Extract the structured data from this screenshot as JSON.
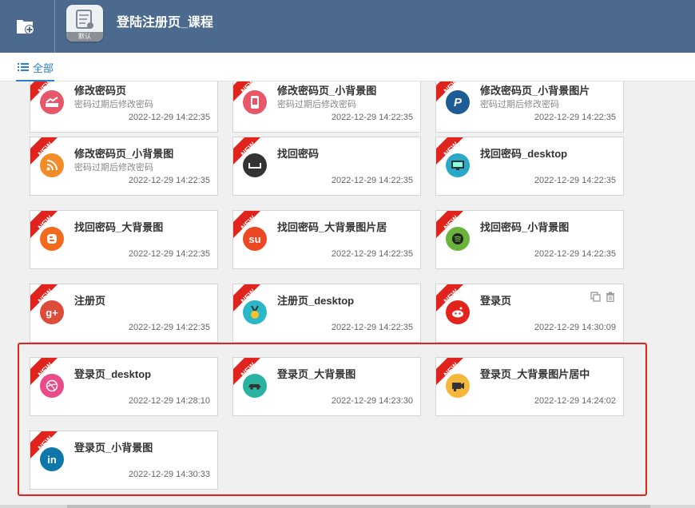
{
  "header": {
    "title": "登陆注册页_课程",
    "app_badge": "默认"
  },
  "tabs": {
    "all_label": "全部"
  },
  "colors": {
    "header_bg": "#4b6a8e",
    "accent": "#2a7fd0",
    "ribbon": "#e0231c",
    "highlight": "#e0231c"
  },
  "cards": [
    {
      "name": "修改密码页",
      "desc": "密码过期后修改密码",
      "time": "2022-12-29 14:22:35",
      "icon": "chart-icon",
      "color": "#e8566a"
    },
    {
      "name": "修改密码页_小背景图",
      "desc": "密码过期后修改密码",
      "time": "2022-12-29 14:22:35",
      "icon": "phone-icon",
      "color": "#e8566a"
    },
    {
      "name": "修改密码页_小背景图片",
      "desc": "密码过期后修改密码",
      "time": "2022-12-29 14:22:35",
      "icon": "paypal-icon",
      "color": "#1d5c95"
    },
    {
      "name": "修改密码页_小背景图",
      "desc": "密码过期后修改密码",
      "time": "2022-12-29 14:22:35",
      "icon": "rss-icon",
      "color": "#f28c28"
    },
    {
      "name": "找回密码",
      "desc": "",
      "time": "2022-12-29 14:22:35",
      "icon": "tray-icon",
      "color": "#333333"
    },
    {
      "name": "找回密码_desktop",
      "desc": "",
      "time": "2022-12-29 14:22:35",
      "icon": "monitor-icon",
      "color": "#2aa8c8"
    },
    {
      "name": "找回密码_大背景图",
      "desc": "",
      "time": "2022-12-29 14:22:35",
      "icon": "blogger-icon",
      "color": "#f26b1d"
    },
    {
      "name": "找回密码_大背景图片居",
      "desc": "",
      "time": "2022-12-29 14:22:35",
      "icon": "stumbleupon-icon",
      "color": "#eb4823"
    },
    {
      "name": "找回密码_小背景图",
      "desc": "",
      "time": "2022-12-29 14:22:35",
      "icon": "spotify-icon",
      "color": "#6ab43e"
    },
    {
      "name": "注册页",
      "desc": "",
      "time": "2022-12-29 14:22:35",
      "icon": "google-plus-icon",
      "color": "#dd4b39",
      "glyph": "g+"
    },
    {
      "name": "注册页_desktop",
      "desc": "",
      "time": "2022-12-29 14:22:35",
      "icon": "medal-icon",
      "color": "#2ab7c8"
    },
    {
      "name": "登录页",
      "desc": "",
      "time": "2022-12-29 14:30:09",
      "icon": "reddit-icon",
      "color": "#e4231c",
      "actions": true
    },
    {
      "name": "登录页_desktop",
      "desc": "",
      "time": "2022-12-29 14:28:10",
      "icon": "dribbble-icon",
      "color": "#ea4c89"
    },
    {
      "name": "登录页_大背景图",
      "desc": "",
      "time": "2022-12-29 14:23:30",
      "icon": "car-icon",
      "color": "#2bb3a2"
    },
    {
      "name": "登录页_大背景图片居中",
      "desc": "",
      "time": "2022-12-29 14:24:02",
      "icon": "camera-icon",
      "color": "#f4b73a"
    },
    {
      "name": "登录页_小背景图",
      "desc": "",
      "time": "2022-12-29 14:30:33",
      "icon": "linkedin-icon",
      "color": "#0e76a8",
      "glyph": "in"
    }
  ]
}
